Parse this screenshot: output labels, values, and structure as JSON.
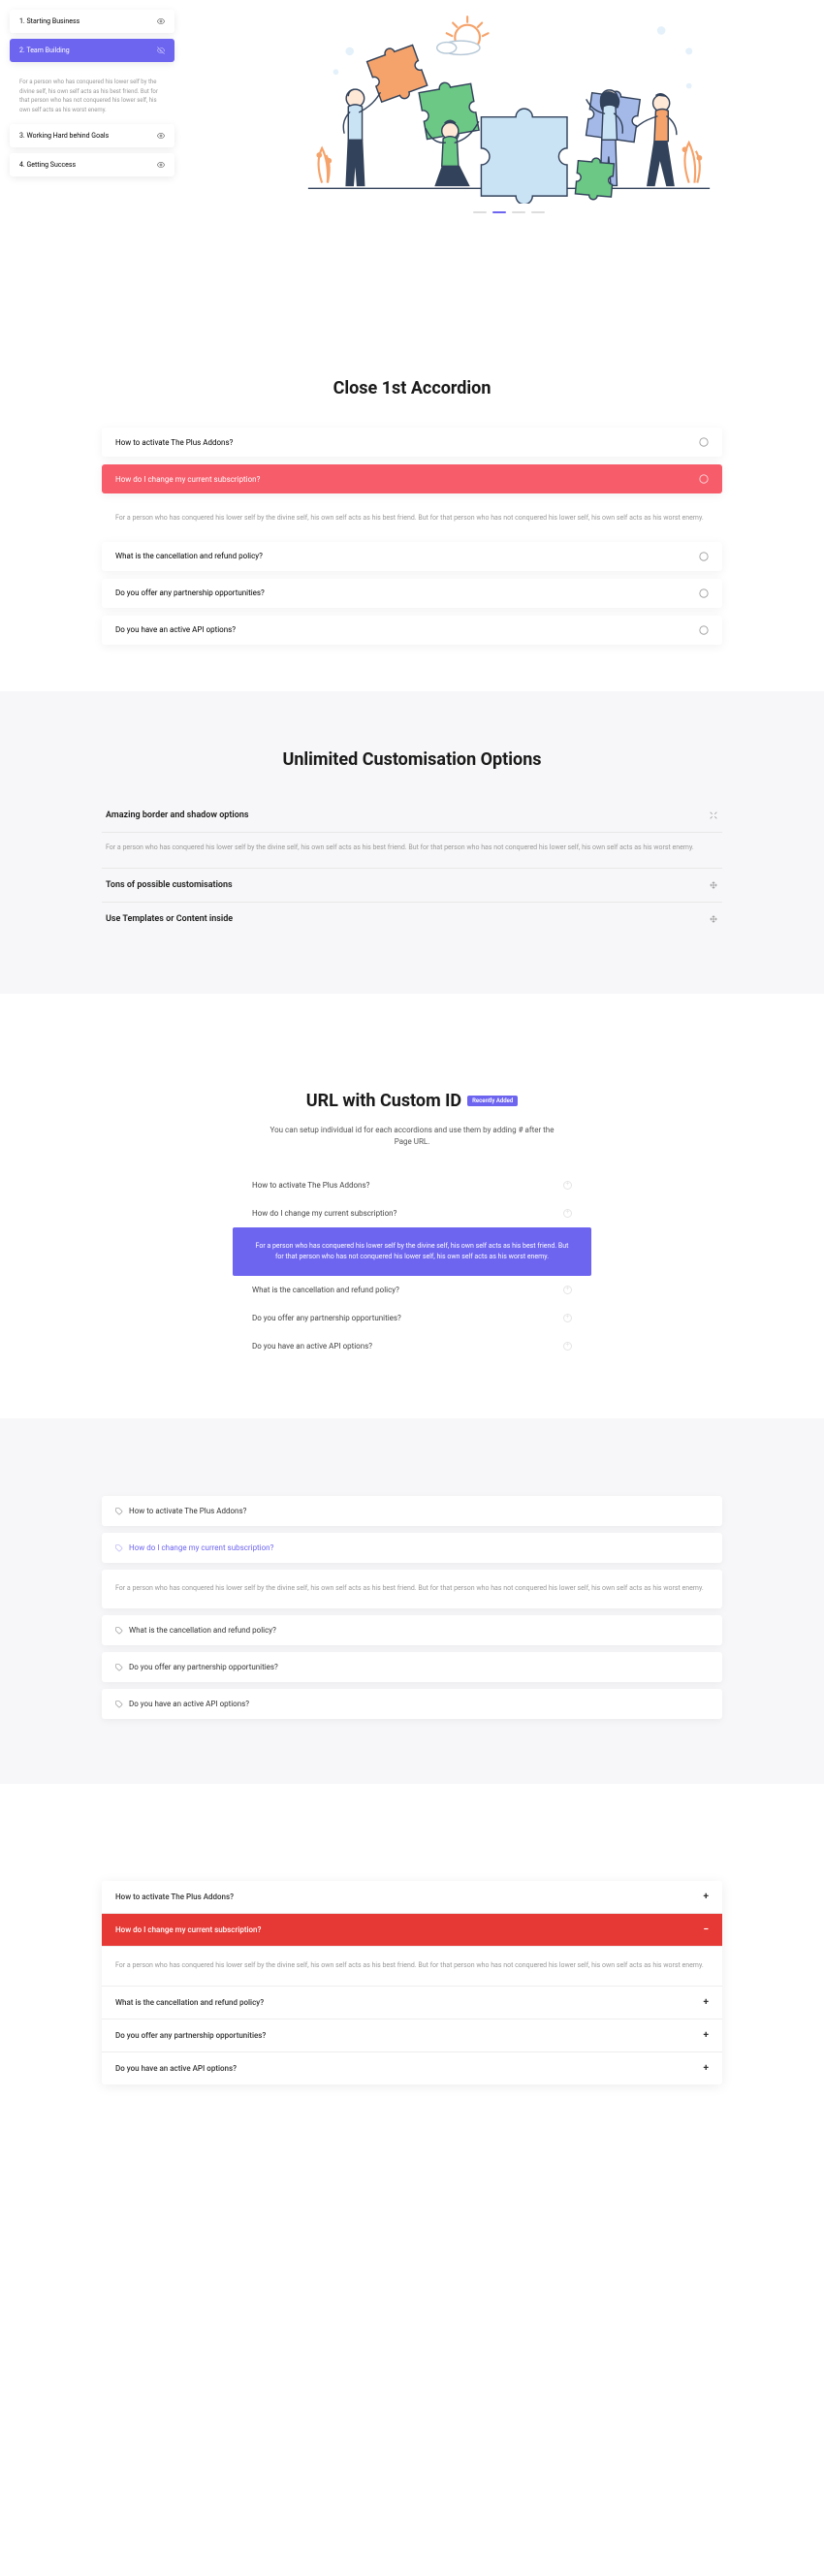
{
  "section1": {
    "items": [
      {
        "label": "1. Starting Business"
      },
      {
        "label": "2. Team Building"
      },
      {
        "label": "3. Working Hard behind Goals"
      },
      {
        "label": "4. Getting Success"
      }
    ],
    "active_index": 1,
    "content": "For a person who has conquered his lower self by the divine self, his own self acts as his best friend. But for that person who has not conquered his lower self, his own self acts as his worst enemy."
  },
  "section2": {
    "title": "Close 1st Accordion",
    "content": "For a person who has conquered his lower self by the divine self, his own self acts as his best friend. But for that person who has not conquered his lower self, his own self acts as his worst enemy.",
    "items": [
      "How to activate The Plus Addons?",
      "How do I change my current subscription?",
      "What is the cancellation and refund policy?",
      "Do you offer any partnership opportunities?",
      "Do you have an active API options?"
    ],
    "active_index": 1
  },
  "section3": {
    "title": "Unlimited Customisation Options",
    "content": "For a person who has conquered his lower self by the divine self, his own self acts as his best friend. But for that person who has not conquered his lower self, his own self acts as his worst enemy.",
    "items": [
      "Amazing border and shadow options",
      "Tons of possible customisations",
      "Use Templates or Content inside"
    ],
    "active_index": 0
  },
  "section4": {
    "title": "URL with Custom ID",
    "badge": "Recently Added",
    "subtitle": "You can setup individual id for each accordions and use them by adding # after the Page URL.",
    "content": "For a person who has conquered his lower self by the divine self, his own self acts as his best friend. But for that person who has not conquered his lower self, his own self acts as his worst enemy.",
    "items": [
      "How to activate The Plus Addons?",
      "How do I change my current subscription?",
      "What is the cancellation and refund policy?",
      "Do you offer any partnership opportunities?",
      "Do you have an active API options?"
    ],
    "active_index": 1
  },
  "section5": {
    "content": "For a person who has conquered his lower self by the divine self, his own self acts as his best friend. But for that person who has not conquered his lower self, his own self acts as his worst enemy.",
    "items": [
      "How to activate The Plus Addons?",
      "How do I change my current subscription?",
      "What is the cancellation and refund policy?",
      "Do you offer any partnership opportunities?",
      "Do you have an active API options?"
    ],
    "active_index": 1
  },
  "section6": {
    "content": "For a person who has conquered his lower self by the divine self, his own self acts as his best friend. But for that person who has not conquered his lower self, his own self acts as his worst enemy.",
    "items": [
      "How to activate The Plus Addons?",
      "How do I change my current subscription?",
      "What is the cancellation and refund policy?",
      "Do you offer any partnership opportunities?",
      "Do you have an active API options?"
    ],
    "active_index": 1
  }
}
